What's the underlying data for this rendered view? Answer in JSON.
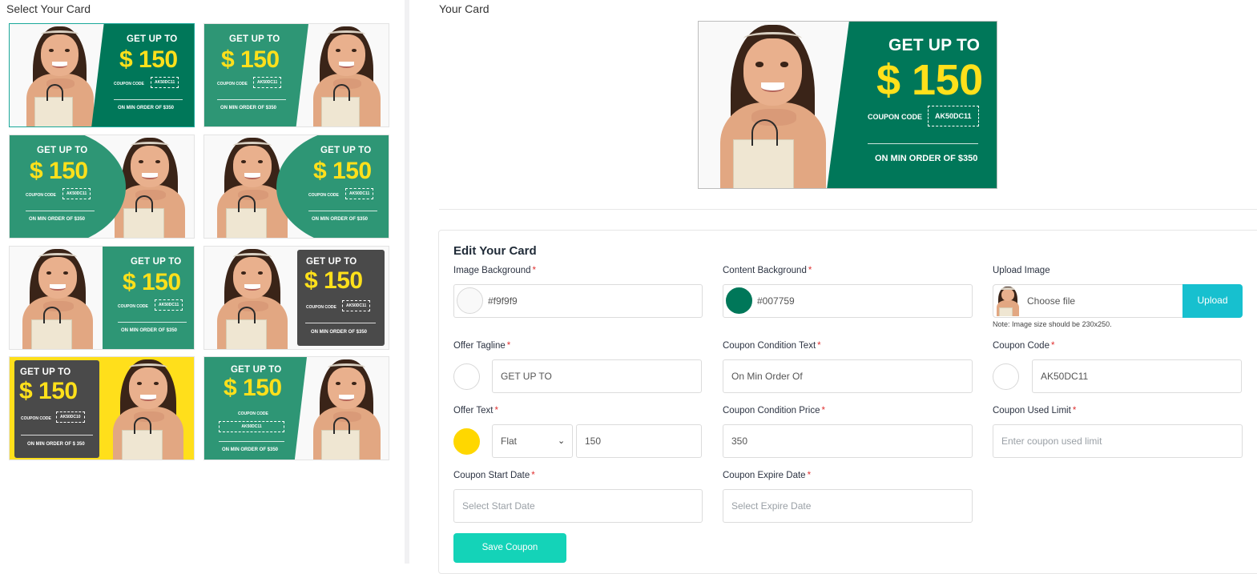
{
  "left_panel": {
    "title": "Select Your Card"
  },
  "coupon": {
    "tagline": "GET UP TO",
    "amount": "$ 150",
    "coupon_code_label": "COUPON CODE",
    "code": "AK50DC11",
    "condition": "ON MIN ORDER OF $350"
  },
  "cards": [
    {
      "code": "AK50DC11",
      "condition": "ON MIN ORDER OF $350"
    },
    {
      "code": "AK50DC11",
      "condition": "ON MIN ORDER OF $350"
    },
    {
      "code": "AK50DC11",
      "condition": "ON MIN ORDER OF $350"
    },
    {
      "code": "AK50DC11",
      "condition": "ON MIN ORDER OF $350"
    },
    {
      "code": "AK50DC11",
      "condition": "ON MIN ORDER OF $350"
    },
    {
      "code": "AK50DC11",
      "condition": "ON MIN ORDER OF $350"
    },
    {
      "code": "AK50DC10",
      "condition": "ON MIN ORDER OF $ 350"
    },
    {
      "code": "AK50DC11",
      "condition": "ON MIN ORDER OF $350"
    }
  ],
  "right_panel": {
    "title": "Your Card"
  },
  "preview": {
    "tagline": "GET UP TO",
    "amount": "$ 150",
    "coupon_code_label": "COUPON CODE",
    "code": "AK50DC11",
    "condition": "ON MIN ORDER OF $350"
  },
  "form": {
    "title": "Edit Your Card",
    "image_background": {
      "label": "Image Background",
      "value": "#f9f9f9"
    },
    "content_background": {
      "label": "Content Background",
      "value": "#007759"
    },
    "upload_image": {
      "label": "Upload Image",
      "file_text": "Choose file",
      "button": "Upload",
      "note": "Note: Image size should be 230x250."
    },
    "offer_tagline": {
      "label": "Offer Tagline",
      "value": "GET UP TO"
    },
    "coupon_condition_text": {
      "label": "Coupon Condition Text",
      "value": "On Min Order Of"
    },
    "coupon_code": {
      "label": "Coupon Code",
      "value": "AK50DC11"
    },
    "offer_text": {
      "label": "Offer Text",
      "type": "Flat",
      "value": "150"
    },
    "coupon_condition_price": {
      "label": "Coupon Condition Price",
      "value": "350"
    },
    "coupon_used_limit": {
      "label": "Coupon Used Limit",
      "placeholder": "Enter coupon used limit"
    },
    "coupon_start_date": {
      "label": "Coupon Start Date",
      "placeholder": "Select Start Date"
    },
    "coupon_expire_date": {
      "label": "Coupon Expire Date",
      "placeholder": "Select Expire Date"
    },
    "save_button": "Save Coupon",
    "required_mark": "*"
  },
  "colors": {
    "green": "#007759",
    "teal_green": "#2e9675",
    "dark_grey": "#4a4a4a",
    "yellow": "#ffdf1b",
    "accent": "#17c0cf",
    "save": "#14d3b8"
  }
}
